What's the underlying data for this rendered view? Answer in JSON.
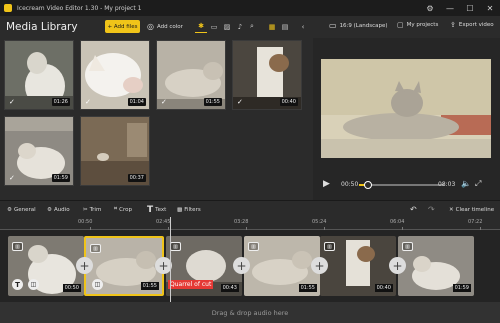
{
  "window": {
    "title": "Icecream Video Editor 1.30 - My project 1"
  },
  "library": {
    "title": "Media Library",
    "add_files": "+ Add files",
    "add_color": "Add color",
    "items": [
      {
        "duration": "01:26",
        "checked": true
      },
      {
        "duration": "01:04",
        "checked": true
      },
      {
        "duration": "01:55",
        "checked": true
      },
      {
        "duration": "00:40",
        "checked": true
      },
      {
        "duration": "01:59",
        "checked": true
      },
      {
        "duration": "00:37",
        "checked": false
      }
    ]
  },
  "right_header": {
    "aspect": "16:9 (Landscape)",
    "projects": "My projects",
    "export": "Export video"
  },
  "player": {
    "current_time": "00:50",
    "total_time": "08:03",
    "progress": 0.1
  },
  "toolbar": {
    "general": "General",
    "audio": "Audio",
    "trim": "Trim",
    "crop": "Crop",
    "text": "Text",
    "filters": "Filters",
    "clear_timeline": "Clear timeline"
  },
  "timeline": {
    "ticks": [
      "00:50",
      "02:45",
      "03:28",
      "05:24",
      "06:04",
      "07:22"
    ],
    "clips": [
      {
        "duration": "00:50"
      },
      {
        "duration": "01:55"
      },
      {
        "duration": "00:43",
        "caption": "Quarrel of cut"
      },
      {
        "duration": "01:55"
      },
      {
        "duration": "00:40"
      },
      {
        "duration": "01:59"
      }
    ],
    "drop_hint": "Drag & drop audio here"
  },
  "colors": {
    "accent": "#f0c419",
    "caption": "#e53935"
  }
}
